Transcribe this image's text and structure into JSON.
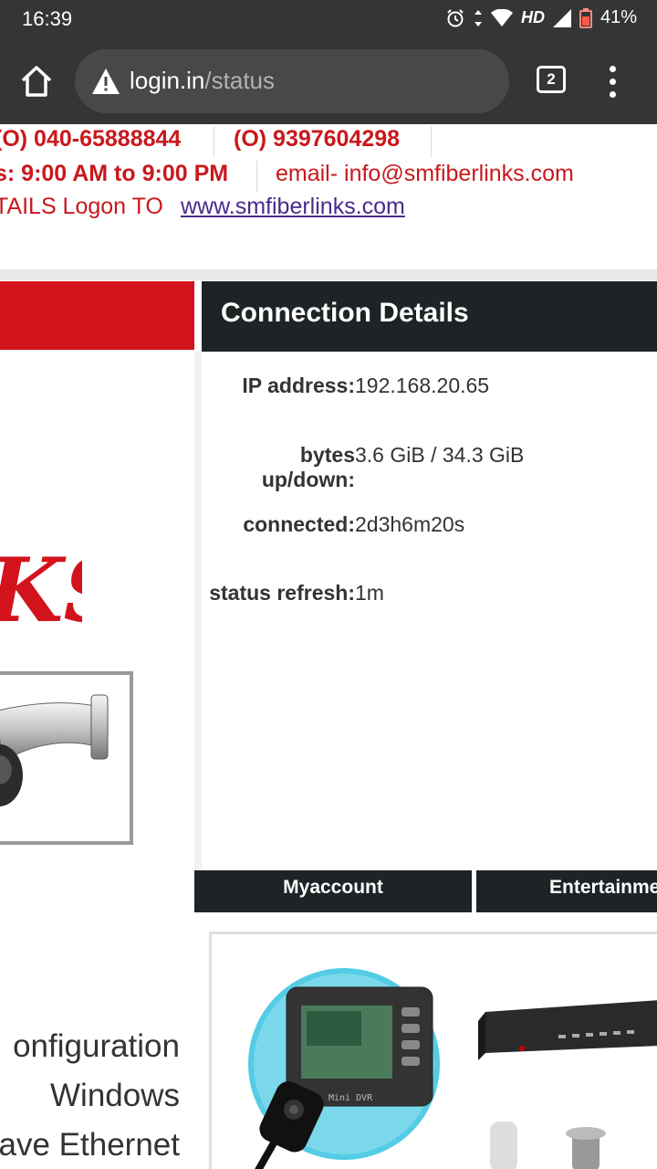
{
  "status_bar": {
    "time": "16:39",
    "network": "HD",
    "battery": "41%"
  },
  "browser": {
    "url_host": "login.in",
    "url_path": "/status",
    "tab_count": "2"
  },
  "contact": {
    "phone1": "(O) 040-65888844",
    "phone2": "(O) 9397604298",
    "hours": "s: 9:00 AM to 9:00 PM",
    "email": "email- info@smfiberlinks.com",
    "details_prefix": "TAILS Logon TO ",
    "details_link": "www.smfiberlinks.com"
  },
  "connection": {
    "title": "Connection Details",
    "rows": [
      {
        "label": "IP address:",
        "value": "192.168.20.65"
      },
      {
        "label": "bytes up/down:",
        "value": "3.6 GiB / 34.3 GiB"
      },
      {
        "label": "connected:",
        "value": "2d3h6m20s"
      },
      {
        "label": "status refresh:",
        "value": "1m"
      }
    ]
  },
  "nav": {
    "items": [
      "Myaccount",
      "Entertainment"
    ]
  },
  "logo_fragment": "KS",
  "side_text": [
    "onfiguration",
    "Windows",
    "ave Ethernet"
  ],
  "product_labels": [
    "Mini DVR"
  ],
  "colors": {
    "brand_red": "#d3131c",
    "dark_header": "#1e2326",
    "link_purple": "#4a2a8c",
    "browser_chrome": "#333537"
  }
}
